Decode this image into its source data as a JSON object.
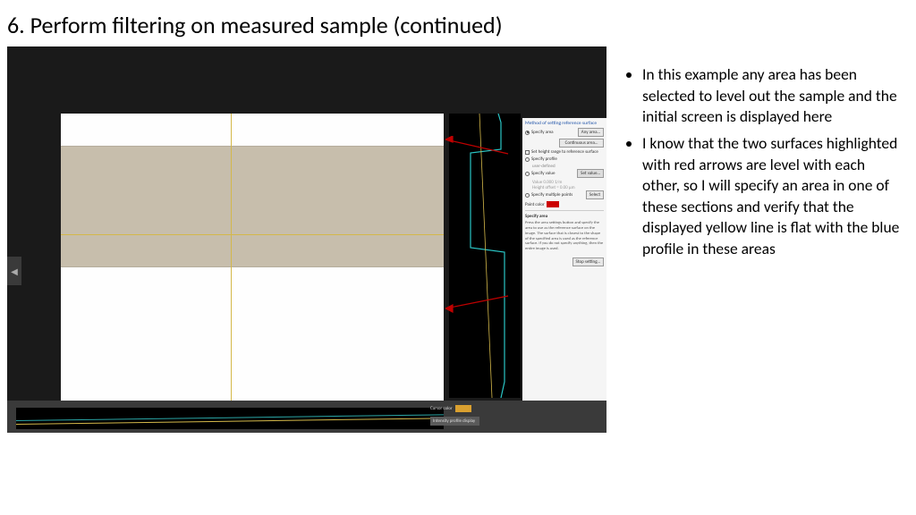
{
  "slide": {
    "title": "6. Perform filtering on measured sample (continued)"
  },
  "bullets": [
    "In this example any area has been selected to level out the sample and the initial screen is displayed here",
    "I know that the two surfaces highlighted with red arrows are level with each other, so I will specify an area in one of these sections and verify that the displayed yellow line is flat with the blue profile in these areas"
  ],
  "sidepanel": {
    "title": "Method of setting reference surface",
    "opt_specify_area": "Specify area",
    "btn_any_area": "Any area…",
    "btn_continuous": "Continuous area…",
    "chk_height_range": "Set height range to reference surface",
    "opt_specify_profile": "Specify profile",
    "profile_sub": "user-defined",
    "opt_specify_value": "Specify value",
    "value_text": "Value   0.000  1/m",
    "btn_set_value": "Set value…",
    "height_offset": "Height offset = 0.00 µm",
    "opt_multiple": "Specify multiple points",
    "btn_select": "Select",
    "paint_color": "Paint color",
    "help_title": "Specify area",
    "help_body": "Press the area settings button and specify the area to use as the reference surface on the image.\nThe surface that is closest to the shape of the specified area is used as the reference surface.\nIf you do not specify anything, then the entire image is used.",
    "btn_stop": "Stop setting…"
  },
  "bottom": {
    "cursor_color": "Cursor color",
    "intensity": "Intensity profile display"
  },
  "colors": {
    "paint_swatch": "#cc0000",
    "cursor_swatch": "#d9a030"
  }
}
